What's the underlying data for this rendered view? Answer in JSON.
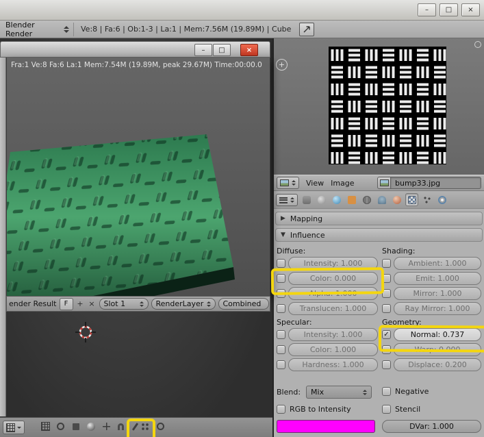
{
  "window_controls": {
    "minimize": "–",
    "maximize": "□",
    "close": "×"
  },
  "icons": {
    "check": "✓",
    "plus": "+",
    "x": "×",
    "arrow_right": "▶",
    "arrow_down": "▼"
  },
  "top_bar": {
    "engine": "Blender Render",
    "stats": "Ve:8 | Fa:6 | Ob:1-3 | La:1 | Mem:7.56M (19.89M) | Cube"
  },
  "render_window": {
    "stats": "Fra:1  Ve:8 Fa:6 La:1 Mem:7.54M (19.89M, peak 29.67M) Time:00:00.0",
    "footer": {
      "result": "ender Result",
      "f": "F",
      "slot": "Slot 1",
      "layer": "RenderLayer",
      "pass": "Combined"
    }
  },
  "image_editor": {
    "view": "View",
    "image": "Image",
    "filename": "bump33.jpg"
  },
  "panels": {
    "mapping": "Mapping",
    "influence": "Influence"
  },
  "influence": {
    "diffuse_label": "Diffuse:",
    "shading_label": "Shading:",
    "specular_label": "Specular:",
    "geometry_label": "Geometry:",
    "diffuse": [
      "Intensity: 1.000",
      "Color: 0.000",
      "Alpha: 1.000",
      "Translucen: 1.000"
    ],
    "shading": [
      "Ambient: 1.000",
      "Emit: 1.000",
      "Mirror: 1.000",
      "Ray Mirror: 1.000"
    ],
    "specular": [
      "Intensity: 1.000",
      "Color: 1.000",
      "Hardness: 1.000"
    ],
    "geometry": [
      "Normal: 0.737",
      "Warp: 0.000",
      "Displace: 0.200"
    ],
    "blend_label": "Blend:",
    "blend_value": "Mix",
    "negative": "Negative",
    "rgb_to_intensity": "RGB to Intensity",
    "stencil": "Stencil",
    "dvar": "DVar: 1.000"
  },
  "colors": {
    "swatch": "#ff00ff",
    "highlight": "#f4d60f"
  }
}
